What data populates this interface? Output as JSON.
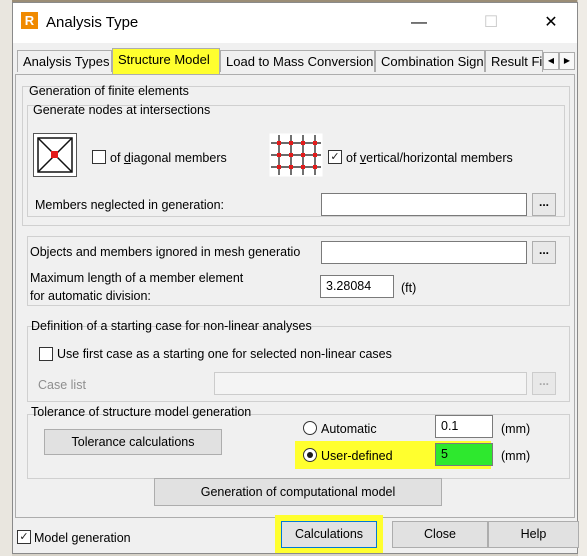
{
  "window": {
    "title": "Analysis Type",
    "app_icon_letter": "R",
    "minimize_glyph": "—",
    "maximize_glyph": "☐",
    "close_glyph": "✕"
  },
  "tabs": [
    {
      "label": "Analysis Types",
      "active": false
    },
    {
      "label": "Structure Model",
      "active": true
    },
    {
      "label": "Load to Mass Conversion",
      "active": false
    },
    {
      "label": "Combination Sign",
      "active": false
    },
    {
      "label": "Result Fi",
      "active": false
    }
  ],
  "tab_scroll": {
    "left": "◀",
    "right": "▶"
  },
  "fe_generation": {
    "title": "Generation of finite elements",
    "nodes_group_title": "Generate nodes at intersections",
    "diagonal": {
      "prefix": "of ",
      "underlined": "d",
      "rest": "iagonal members",
      "checked": false
    },
    "vertical": {
      "prefix": "of ",
      "underlined": "v",
      "rest": "ertical/horizontal members",
      "checked": true,
      "check_mark": "✓"
    },
    "neglected_label": "Members neglected in generation:",
    "neglected_value": "",
    "browse_label": "..."
  },
  "mesh": {
    "ignored_label": "Objects and members ignored in mesh generatio",
    "ignored_value": "",
    "browse_label": "...",
    "max_length_label_1": "Maximum length of a member element",
    "max_length_label_2": "for automatic division:",
    "max_length_value": "3.28084",
    "max_length_unit": "(ft)"
  },
  "nonlinear": {
    "title": "Definition of a starting case for non-linear analyses",
    "use_first_label": "Use first case as a starting one for selected non-linear cases",
    "use_first_checked": false,
    "case_list_label": "Case list",
    "case_list_value": "",
    "browse_label": "..."
  },
  "tolerance": {
    "title": "Tolerance of structure model generation",
    "calc_button": "Tolerance calculations",
    "automatic_label": "Automatic",
    "automatic_value": "0.1",
    "automatic_unit": "(mm)",
    "user_defined_label": "User-defined",
    "user_defined_value": "5",
    "user_defined_unit": "(mm)",
    "selected": "user_defined"
  },
  "generate_button": "Generation of computational model",
  "footer": {
    "model_generation_label": "Model generation",
    "model_generation_checked": true,
    "check_mark": "✓",
    "calculations_button": "Calculations",
    "close_button": "Close",
    "help_button": "Help"
  },
  "colors": {
    "highlight": "#ffff2e",
    "selected_input": "#2ee82e",
    "node_marker": "#e31b1b"
  }
}
